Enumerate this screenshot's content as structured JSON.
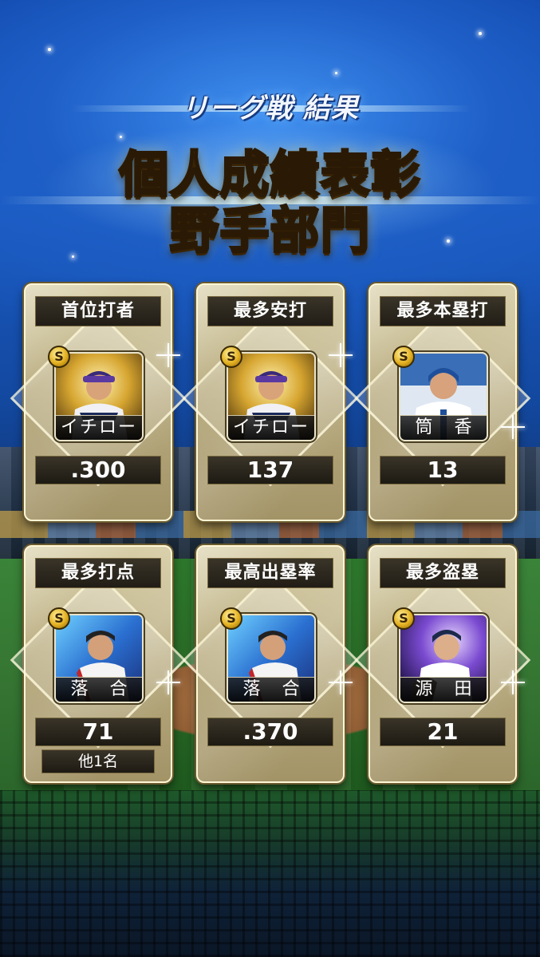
{
  "header": {
    "subtitle": "リーグ戦 結果",
    "title_line1": "個人成績表彰",
    "title_line2": "野手部門"
  },
  "badge_label": "S",
  "awards": [
    {
      "category": "首位打者",
      "player": "イチロー",
      "stat": ".300",
      "card_theme": "gold"
    },
    {
      "category": "最多安打",
      "player": "イチロー",
      "stat": "137",
      "card_theme": "gold"
    },
    {
      "category": "最多本塁打",
      "player": "筒 香",
      "stat": "13",
      "card_theme": "white"
    },
    {
      "category": "最多打点",
      "player": "落 合",
      "stat": "71",
      "others": "他1名",
      "card_theme": "blue"
    },
    {
      "category": "最高出塁率",
      "player": "落 合",
      "stat": ".370",
      "card_theme": "blue"
    },
    {
      "category": "最多盗塁",
      "player": "源 田",
      "stat": "21",
      "card_theme": "purple"
    }
  ],
  "colors": {
    "title_gold": "#ffd23a",
    "card_gold": "#b9ac80",
    "sky_blue": "#1e5fc7",
    "label_dark": "#211d16"
  }
}
